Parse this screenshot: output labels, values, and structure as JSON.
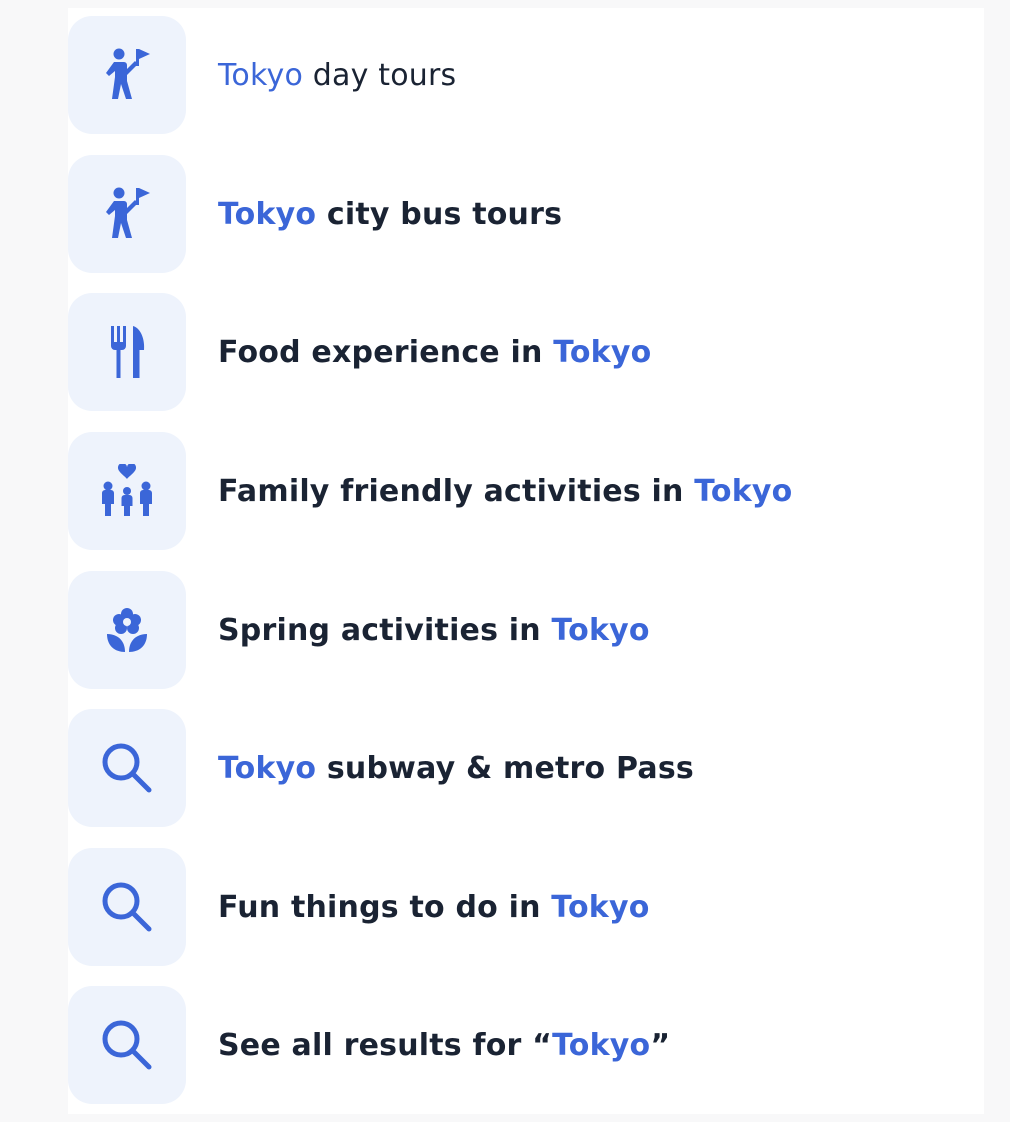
{
  "accent_color": "#3b66d8",
  "text_color": "#1a2333",
  "tile_color": "#eef3fc",
  "query": "Tokyo",
  "suggestions": [
    {
      "icon": "tour-guide-flag-icon",
      "before": "",
      "highlight": "Tokyo",
      "after": " day tours"
    },
    {
      "icon": "tour-guide-flag-icon",
      "before": "",
      "highlight": "Tokyo",
      "after": " city bus tours"
    },
    {
      "icon": "fork-knife-icon",
      "before": "Food experience in ",
      "highlight": "Tokyo",
      "after": ""
    },
    {
      "icon": "family-heart-icon",
      "before": "Family friendly activities in ",
      "highlight": "Tokyo",
      "after": ""
    },
    {
      "icon": "flower-icon",
      "before": "Spring activities in ",
      "highlight": "Tokyo",
      "after": ""
    },
    {
      "icon": "search-icon",
      "before": "",
      "highlight": "Tokyo",
      "after": " subway & metro Pass"
    },
    {
      "icon": "search-icon",
      "before": "Fun things to do in ",
      "highlight": "Tokyo",
      "after": ""
    },
    {
      "icon": "search-icon",
      "before": "See all results for “",
      "highlight": "Tokyo",
      "after": "”"
    }
  ]
}
